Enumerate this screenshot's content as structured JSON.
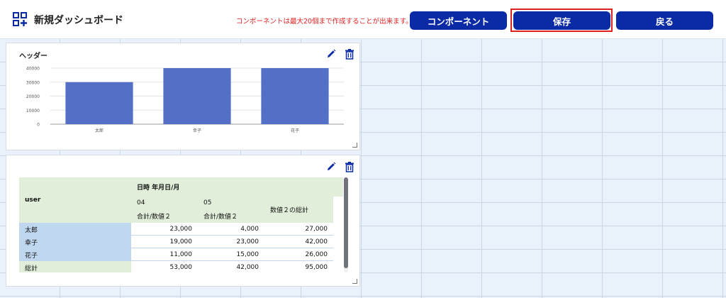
{
  "header": {
    "title": "新規ダッシュボード",
    "notice": "コンポーネントは最大20個まで作成することが出来ます。",
    "buttons": {
      "component": "コンポーネント",
      "save": "保存",
      "back": "戻る"
    }
  },
  "colors": {
    "primary": "#0a2aa6",
    "bar": "#5470c6",
    "highlight": "#e02020"
  },
  "chart_card": {
    "title": "ヘッダー",
    "chart_data": {
      "type": "bar",
      "categories": [
        "太郎",
        "幸子",
        "花子"
      ],
      "values": [
        30000,
        40000,
        40000
      ],
      "ylim": [
        0,
        40000
      ],
      "yticks": [
        "0",
        "10000",
        "20000",
        "30000",
        "40000"
      ],
      "grid": true
    }
  },
  "table_card": {
    "pivot": {
      "row_header": "user",
      "col_group": "日時 年月日/月",
      "months": [
        "04",
        "05"
      ],
      "measure": "合計/数値２",
      "total_header": "数値２の総計",
      "rows": [
        {
          "label": "太郎",
          "m04": "23,000",
          "m05": "4,000",
          "total": "27,000"
        },
        {
          "label": "幸子",
          "m04": "19,000",
          "m05": "23,000",
          "total": "42,000"
        },
        {
          "label": "花子",
          "m04": "11,000",
          "m05": "15,000",
          "total": "26,000"
        },
        {
          "label": "総計",
          "m04": "53,000",
          "m05": "42,000",
          "total": "95,000"
        }
      ]
    }
  }
}
